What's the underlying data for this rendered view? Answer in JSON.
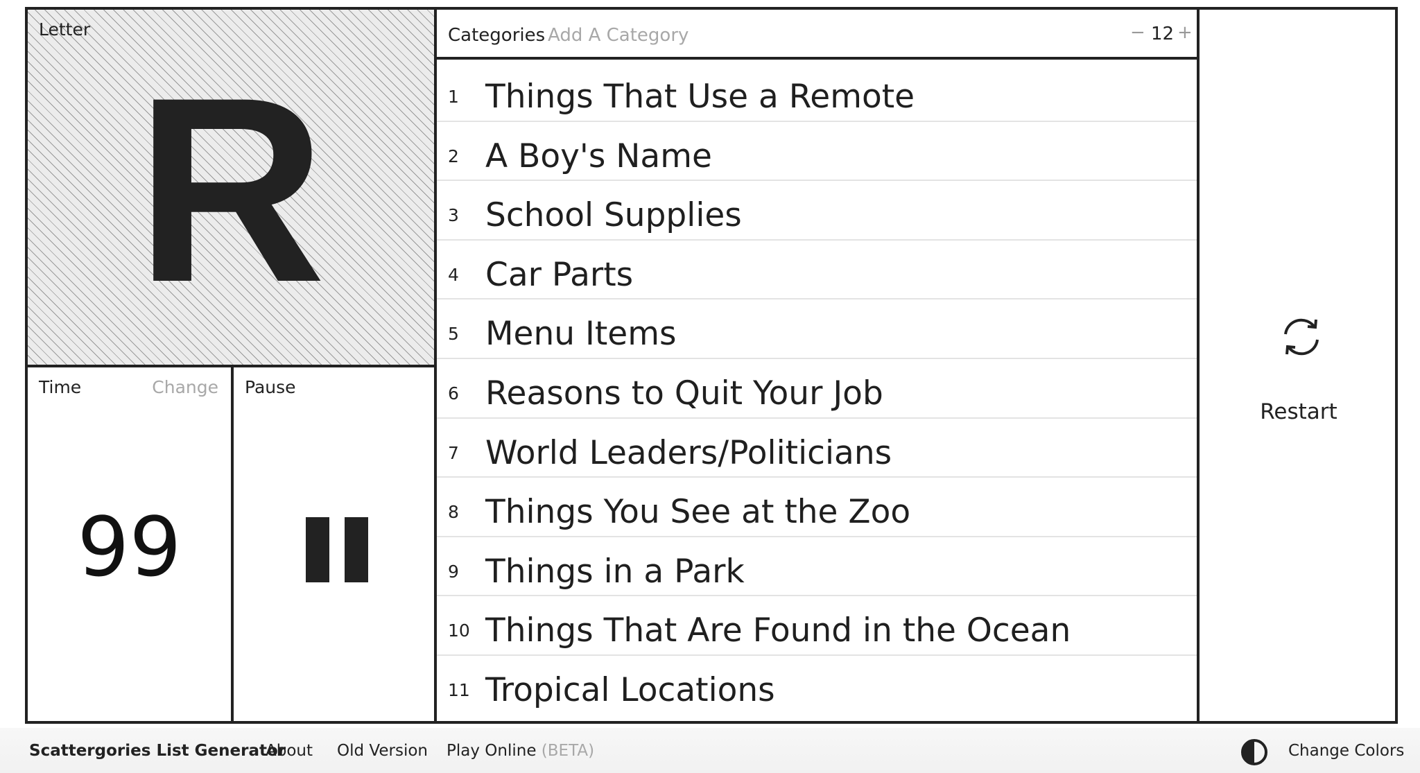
{
  "letter_panel": {
    "label": "Letter",
    "letter": "R"
  },
  "time_panel": {
    "label": "Time",
    "change_label": "Change",
    "value": "99"
  },
  "pause_panel": {
    "label": "Pause",
    "icon": "pause-icon"
  },
  "categories_panel": {
    "title": "Categories",
    "add_label": "Add A Category",
    "count_minus": "−",
    "count": "12",
    "count_plus": "+",
    "items": [
      {
        "num": "1",
        "text": "Things That Use a Remote"
      },
      {
        "num": "2",
        "text": "A Boy's Name"
      },
      {
        "num": "3",
        "text": "School Supplies"
      },
      {
        "num": "4",
        "text": "Car Parts"
      },
      {
        "num": "5",
        "text": "Menu Items"
      },
      {
        "num": "6",
        "text": "Reasons to Quit Your Job"
      },
      {
        "num": "7",
        "text": "World Leaders/Politicians"
      },
      {
        "num": "8",
        "text": "Things You See at the Zoo"
      },
      {
        "num": "9",
        "text": "Things in a Park"
      },
      {
        "num": "10",
        "text": "Things That Are Found in the Ocean"
      },
      {
        "num": "11",
        "text": "Tropical Locations"
      }
    ]
  },
  "restart_panel": {
    "label": "Restart",
    "icon": "refresh-icon"
  },
  "footer": {
    "brand": "Scattergories List Generator",
    "about": "About",
    "old_version": "Old Version",
    "play_online": "Play Online",
    "beta": "(BETA)",
    "change_colors": "Change Colors",
    "colors_icon": "contrast-icon"
  },
  "colors": {
    "ink": "#222222",
    "muted": "#a8a8a8",
    "background": "#ffffff"
  }
}
